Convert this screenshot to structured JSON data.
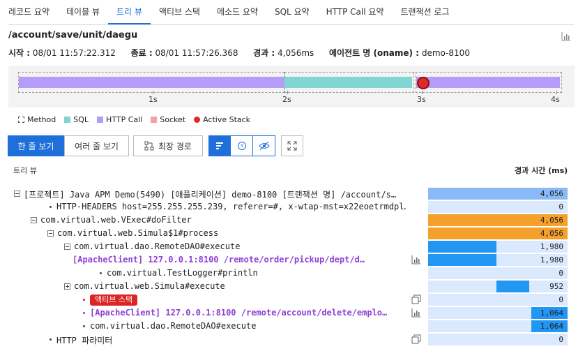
{
  "tabs": [
    {
      "label": "레코드 요약"
    },
    {
      "label": "테이블 뷰"
    },
    {
      "label": "트리 뷰"
    },
    {
      "label": "액티브 스택"
    },
    {
      "label": "메소드 요약"
    },
    {
      "label": "SQL 요약"
    },
    {
      "label": "HTTP Call 요약"
    },
    {
      "label": "트랜잭션 로그"
    }
  ],
  "active_tab": "트리 뷰",
  "header": {
    "title": "/account/save/unit/daegu",
    "start_label": "시작 :",
    "start_value": "08/01 11:57:22.312",
    "end_label": "종료 :",
    "end_value": "08/01 11:57:26.368",
    "elapsed_label": "경과 :",
    "elapsed_value": "4,056ms",
    "agent_label": "에이전트 명 (oname) :",
    "agent_value": "demo-8100"
  },
  "timeline": {
    "ticks": [
      "1s",
      "2s",
      "3s",
      "4s"
    ],
    "segments": [
      {
        "type": "HTTP Call",
        "start": 0,
        "end": 1.98
      },
      {
        "type": "SQL",
        "start": 1.98,
        "end": 3.0
      },
      {
        "type": "HTTP Call",
        "start": 3.0,
        "end": 4.056
      }
    ],
    "active_stack_at": 3.05
  },
  "legend": [
    {
      "label": "Method",
      "color": "#555555"
    },
    {
      "label": "SQL",
      "color": "#7fd6d2"
    },
    {
      "label": "HTTP Call",
      "color": "#b49cf8"
    },
    {
      "label": "Socket",
      "color": "#f4a3a3"
    },
    {
      "label": "Active Stack",
      "color": "#e02828"
    }
  ],
  "toolbar": {
    "single_line": "한 줄 보기",
    "multi_line": "여러 줄 보기",
    "longest_path": "최장 경로"
  },
  "tree": {
    "label": "트리 뷰",
    "elapsed_header": "경과 시간 (ms)",
    "max": 4056,
    "rows": [
      {
        "text": "[프로젝트] Java APM Demo(5490) [애플리케이션] demo-8100 [트랜잭션 명] /account/s…",
        "value_label": "4,056",
        "value": 4056,
        "offset": 0,
        "color": "#8ab9f7",
        "marker": "minus",
        "style": "normal"
      },
      {
        "text": "HTTP-HEADERS host=255.255.255.239, referer=#, x-wtap-mst=x22eoetrmdpl…",
        "value_label": "0",
        "value": 0,
        "offset": 0,
        "color": "#2196f3",
        "marker": "bullet",
        "style": "normal"
      },
      {
        "text": "com.virtual.web.VExec#doFilter",
        "value_label": "4,056",
        "value": 4056,
        "offset": 0,
        "color": "#f5a02a",
        "marker": "minus",
        "style": "normal"
      },
      {
        "text": "com.virtual.web.Simula$1#process",
        "value_label": "4,056",
        "value": 4056,
        "offset": 0,
        "color": "#f5a02a",
        "marker": "minus",
        "style": "normal"
      },
      {
        "text": "com.virtual.dao.RemoteDAO#execute",
        "value_label": "1,980",
        "value": 1980,
        "offset": 0,
        "color": "#2196f3",
        "marker": "minus",
        "style": "normal"
      },
      {
        "text": "[ApacheClient] 127.0.0.1:8100 /remote/order/pickup/dept/d…",
        "value_label": "1,980",
        "value": 1980,
        "offset": 0,
        "color": "#2196f3",
        "marker": "none",
        "style": "purple",
        "icon": "chart-icon"
      },
      {
        "text": "com.virtual.TestLogger#println",
        "value_label": "0",
        "value": 0,
        "offset": 0,
        "color": "#2196f3",
        "marker": "bullet",
        "style": "normal"
      },
      {
        "text": "com.virtual.web.Simula#execute",
        "value_label": "952",
        "value": 952,
        "offset": 1980,
        "color": "#2196f3",
        "marker": "plus",
        "style": "normal"
      },
      {
        "text": "액티브 스택",
        "value_label": "0",
        "value": 0,
        "offset": 0,
        "color": "#2196f3",
        "marker": "bullet-red",
        "style": "badge",
        "icon": "copy-icon"
      },
      {
        "text": "[ApacheClient] 127.0.0.1:8100 /remote/account/delete/emplo…",
        "value_label": "1,064",
        "value": 1064,
        "offset": 2992,
        "color": "#2196f3",
        "marker": "bullet-purple",
        "style": "purple",
        "icon": "chart-icon"
      },
      {
        "text": "com.virtual.dao.RemoteDAO#execute",
        "value_label": "1,064",
        "value": 1064,
        "offset": 2992,
        "color": "#2196f3",
        "marker": "bullet",
        "style": "normal"
      },
      {
        "text": "HTTP 파라미터",
        "value_label": "0",
        "value": 0,
        "offset": 0,
        "color": "#2196f3",
        "marker": "bullet",
        "style": "normal",
        "icon": "copy-icon"
      }
    ]
  }
}
